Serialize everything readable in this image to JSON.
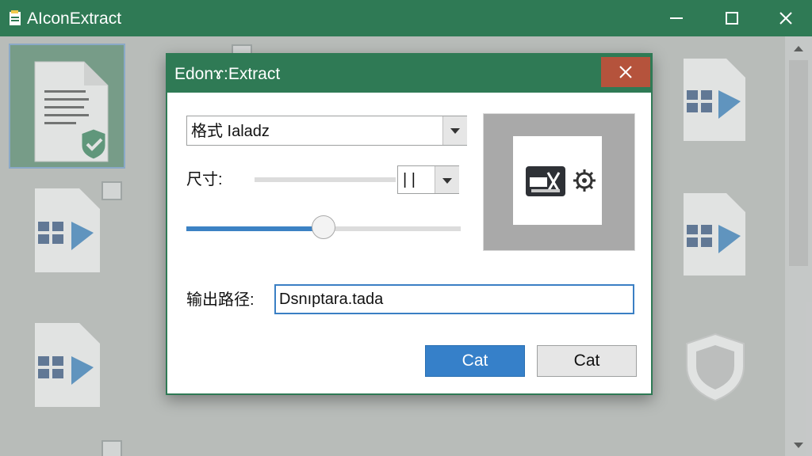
{
  "app": {
    "title": "AIconExtract",
    "icon": "app-document-icon",
    "window_controls": [
      "minimize-icon",
      "maximize-icon",
      "close-icon"
    ]
  },
  "background": {
    "tiles": [
      "document-check-icon",
      "grid-icon",
      "grid-icon",
      "shield-icon"
    ],
    "checkboxes": 3
  },
  "dialog": {
    "title": "Edonɤ:Extract",
    "format_select": {
      "value": "格式 Ialadz"
    },
    "size": {
      "label": "尺寸:",
      "value": "| |"
    },
    "slider": {
      "fraction": 0.5
    },
    "preview": {
      "icons": [
        "image-icon",
        "gear-icon"
      ]
    },
    "path": {
      "label": "输出路径:",
      "value": "Dsnıptara.tada"
    },
    "buttons": {
      "primary": "Cat",
      "secondary": "Cat"
    },
    "colors": {
      "accent": "#2f7a55",
      "primary": "#3680c9",
      "close": "#b5533c"
    }
  }
}
